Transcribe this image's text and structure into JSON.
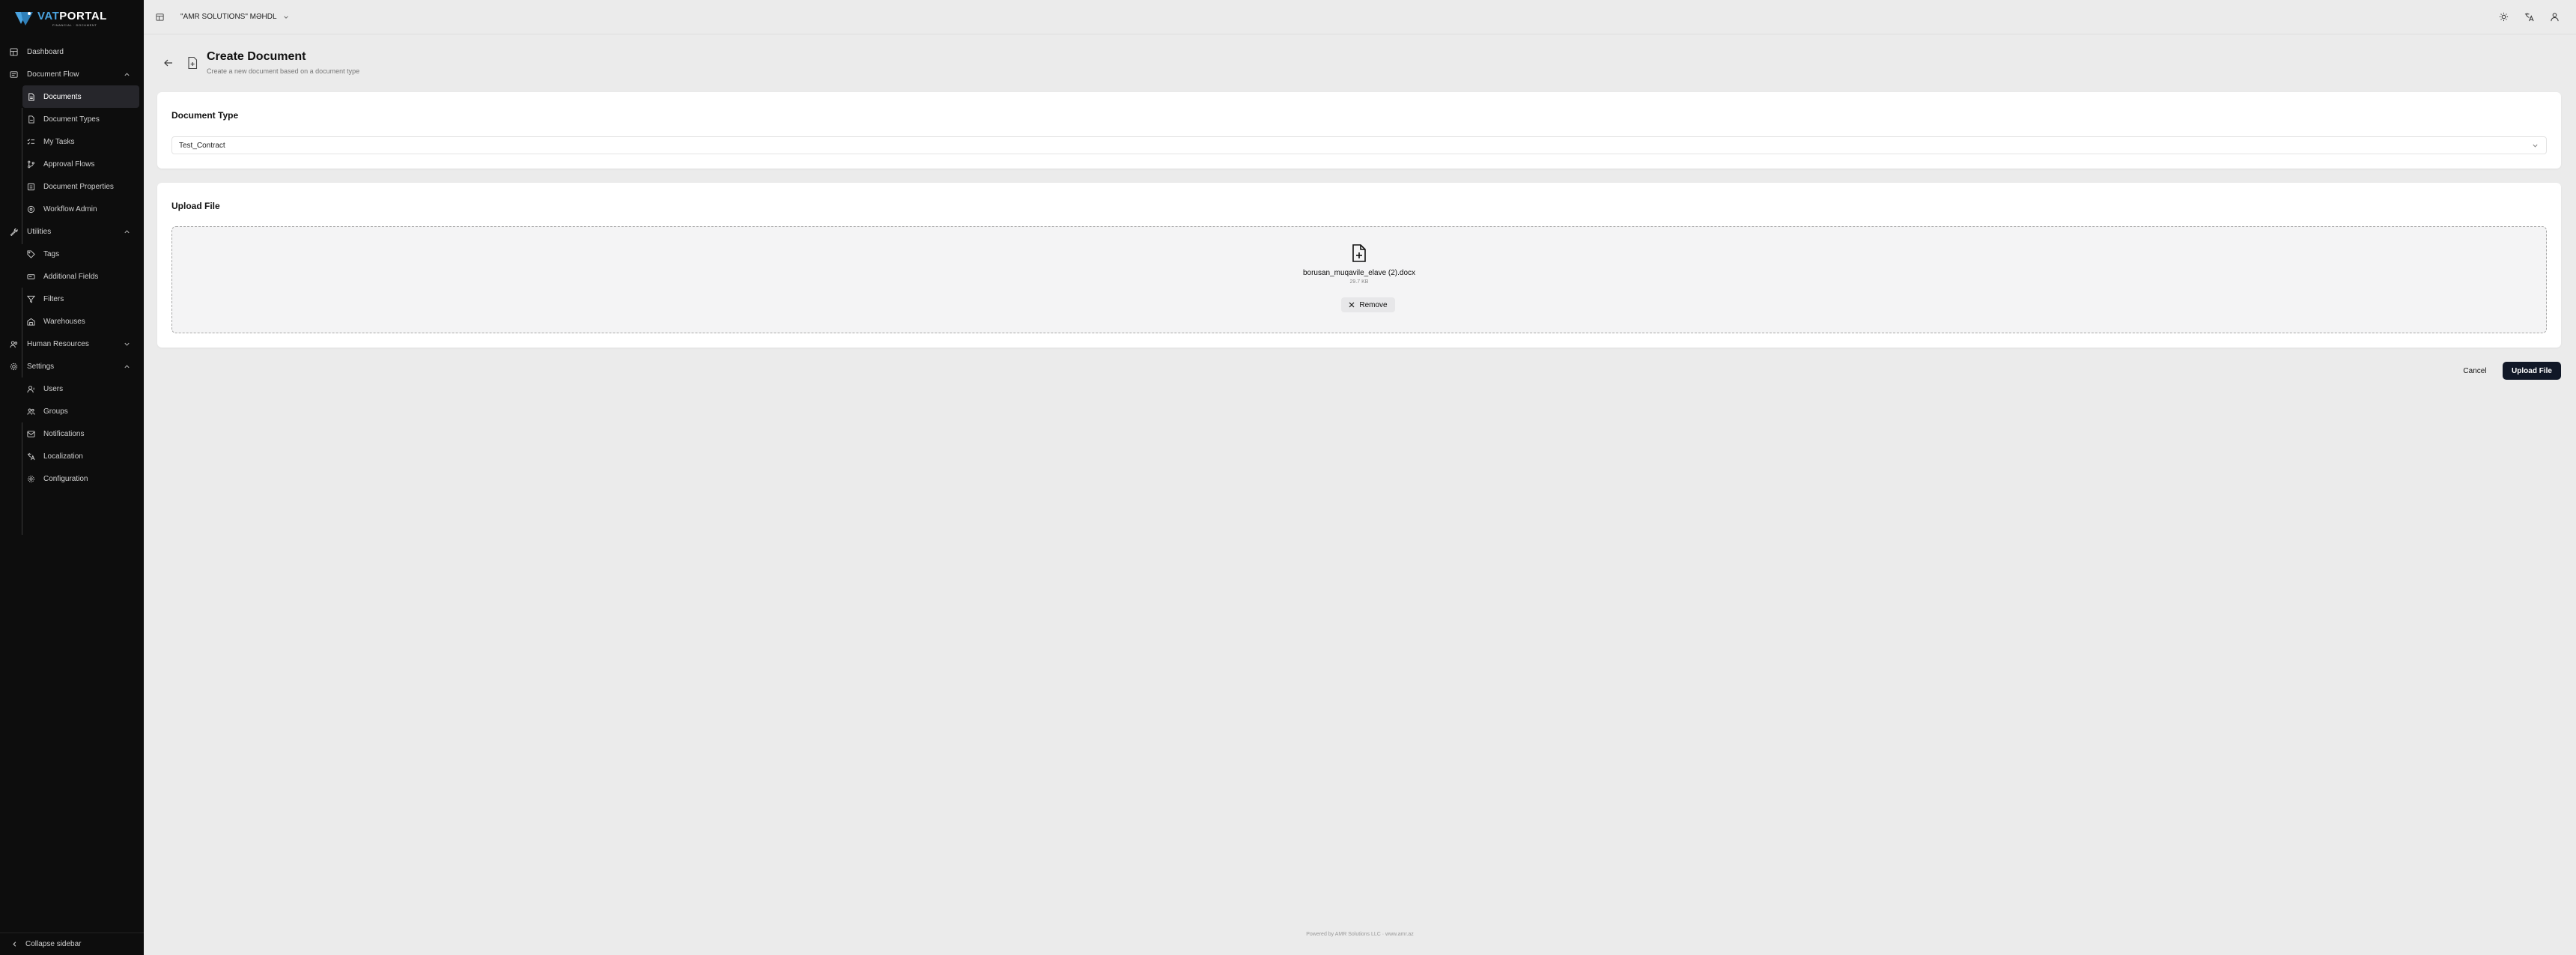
{
  "brand": {
    "name_part1": "VAT",
    "name_part2": "PORTAL",
    "tagline": "FINANCIAL · DOCUMENT",
    "accent_color": "#4aa3df"
  },
  "sidebar": {
    "items": [
      {
        "label": "Dashboard",
        "icon": "dashboard-icon"
      },
      {
        "label": "Document Flow",
        "icon": "document-flow-icon"
      },
      {
        "label": "Documents",
        "icon": "file-icon"
      },
      {
        "label": "Document Types",
        "icon": "file-types-icon"
      },
      {
        "label": "My Tasks",
        "icon": "tasks-icon"
      },
      {
        "label": "Approval Flows",
        "icon": "git-flow-icon"
      },
      {
        "label": "Document Properties",
        "icon": "properties-icon"
      },
      {
        "label": "Workflow Admin",
        "icon": "workflow-icon"
      },
      {
        "label": "Utilities",
        "icon": "wrench-icon"
      },
      {
        "label": "Tags",
        "icon": "tag-icon"
      },
      {
        "label": "Additional Fields",
        "icon": "fields-icon"
      },
      {
        "label": "Filters",
        "icon": "filter-icon"
      },
      {
        "label": "Warehouses",
        "icon": "warehouse-icon"
      },
      {
        "label": "Human Resources",
        "icon": "users-icon"
      },
      {
        "label": "Settings",
        "icon": "gear-icon"
      },
      {
        "label": "Users",
        "icon": "user-icon"
      },
      {
        "label": "Groups",
        "icon": "group-icon"
      },
      {
        "label": "Notifications",
        "icon": "bell-icon"
      },
      {
        "label": "Localization",
        "icon": "language-icon"
      },
      {
        "label": "Configuration",
        "icon": "config-icon"
      }
    ],
    "collapse_label": "Collapse sidebar"
  },
  "topbar": {
    "company": "\"AMR SOLUTIONS\" MƏHDL"
  },
  "header": {
    "title": "Create Document",
    "subtitle": "Create a new document based on a document type"
  },
  "document_type": {
    "title": "Document Type",
    "selected": "Test_Contract"
  },
  "upload": {
    "title": "Upload File",
    "file_name": "borusan_muqavile_elave (2).docx",
    "file_size": "29.7 KB",
    "remove_label": "Remove"
  },
  "actions": {
    "cancel_label": "Cancel",
    "upload_label": "Upload File",
    "primary_color": "#111827"
  },
  "footer": {
    "text": "Powered by AMR Solutions LLC · www.amr.az"
  }
}
